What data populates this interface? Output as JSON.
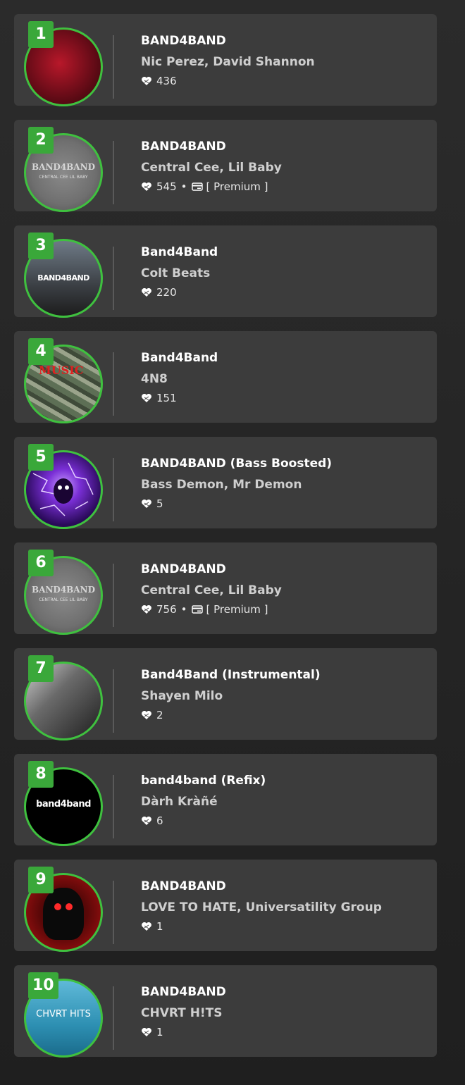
{
  "colors": {
    "accent": "#3fc13f",
    "rank_bg": "#3aa83a",
    "card_bg": "#3c3c3c"
  },
  "icons": {
    "likes": "heart-icon",
    "premium": "card-icon"
  },
  "tracks": [
    {
      "rank": "1",
      "title": "BAND4BAND",
      "artist": "Nic Perez, David Shannon",
      "likes": "436",
      "premium": ""
    },
    {
      "rank": "2",
      "title": "BAND4BAND",
      "artist": "Central Cee, Lil Baby",
      "likes": "545",
      "premium": "[ Premium ]",
      "art_text": "BAND4BAND",
      "art_sub": "CENTRAL CEE    LIL BABY"
    },
    {
      "rank": "3",
      "title": "Band4Band",
      "artist": "Colt Beats",
      "likes": "220",
      "premium": "",
      "art_text": "BAND4BAND"
    },
    {
      "rank": "4",
      "title": "Band4Band",
      "artist": "4N8",
      "likes": "151",
      "premium": "",
      "art_text": "MUSIC"
    },
    {
      "rank": "5",
      "title": "BAND4BAND (Bass Boosted)",
      "artist": "Bass Demon, Mr Demon",
      "likes": "5",
      "premium": ""
    },
    {
      "rank": "6",
      "title": "BAND4BAND",
      "artist": "Central Cee, Lil Baby",
      "likes": "756",
      "premium": "[ Premium ]",
      "art_text": "BAND4BAND",
      "art_sub": "CENTRAL CEE    LIL BABY"
    },
    {
      "rank": "7",
      "title": "Band4Band (Instrumental)",
      "artist": "Shayen Milo",
      "likes": "2",
      "premium": ""
    },
    {
      "rank": "8",
      "title": "band4band (Refix)",
      "artist": "Dàrh Kràñé",
      "likes": "6",
      "premium": "",
      "art_text": "band4band"
    },
    {
      "rank": "9",
      "title": "BAND4BAND",
      "artist": "LOVE TO HATE, Universatility Group",
      "likes": "1",
      "premium": ""
    },
    {
      "rank": "10",
      "title": "BAND4BAND",
      "artist": "CHVRT H!TS",
      "likes": "1",
      "premium": "",
      "art_text": "CHVRT HITS"
    }
  ]
}
